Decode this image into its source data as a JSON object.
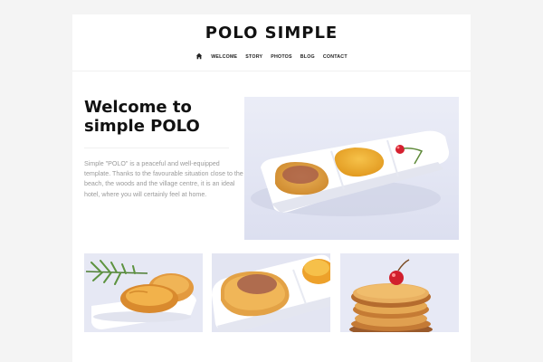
{
  "site": {
    "brand": "POLO SIMPLE"
  },
  "nav": {
    "home_icon": "home-icon",
    "items": [
      {
        "label": "WELCOME"
      },
      {
        "label": "STORY"
      },
      {
        "label": "PHOTOS"
      },
      {
        "label": "BLOG"
      },
      {
        "label": "CONTACT"
      }
    ]
  },
  "hero": {
    "title": "Welcome to simple POLO",
    "text": "Simple \"POLO\" is a peaceful and well-equipped template. Thanks to the favourable situation close to the beach, the woods and the village centre, it is an ideal hotel, where you will certainly feel at home."
  }
}
